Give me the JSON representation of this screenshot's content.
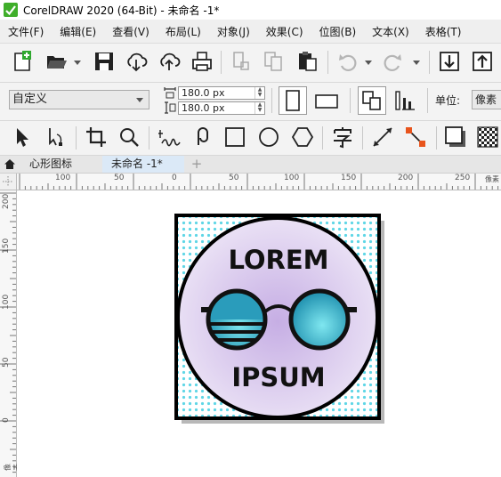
{
  "window": {
    "title": "CorelDRAW 2020 (64-Bit) - 未命名 -1*"
  },
  "menu": [
    "文件(F)",
    "编辑(E)",
    "查看(V)",
    "布局(L)",
    "对象(J)",
    "效果(C)",
    "位图(B)",
    "文本(X)",
    "表格(T)"
  ],
  "property_bar": {
    "preset": "自定义",
    "width": "180.0 px",
    "height": "180.0 px",
    "units_label": "单位:",
    "units": "像素"
  },
  "tabs": {
    "doc1": "心形图标",
    "doc2": "未命名 -1*",
    "add": "+"
  },
  "rulers": {
    "horizontal": [
      "100",
      "50",
      "0",
      "50",
      "100",
      "150",
      "200",
      "250"
    ],
    "vertical": [
      "200",
      "150",
      "100",
      "50",
      "0"
    ],
    "h_unit": "像素",
    "v_unit": "像素"
  },
  "artwork": {
    "line1": "LOREM",
    "line2": "IPSUM",
    "colors": {
      "stroke": "#000000",
      "circle_center": "#c6aee4",
      "circle_edge": "#ece4f6",
      "lens_light": "#7fe7f0",
      "lens_dark": "#1e8fae",
      "dots": "#5fd6e6",
      "shadow": "#b8b8b8"
    }
  },
  "icons": {
    "toolbar_standard": [
      "new-document-icon",
      "open-folder-icon",
      "save-icon",
      "cloud-download-icon",
      "cloud-upload-icon",
      "print-icon",
      "cut-icon",
      "copy-icon",
      "paste-icon",
      "undo-icon",
      "redo-icon",
      "import-icon",
      "export-icon"
    ],
    "toolbox": [
      "pick-tool-icon",
      "shape-tool-icon",
      "crop-tool-icon",
      "zoom-tool-icon",
      "freehand-tool-icon",
      "artistic-media-icon",
      "rectangle-tool-icon",
      "ellipse-tool-icon",
      "polygon-tool-icon",
      "text-tool-icon",
      "parallel-dimension-icon",
      "connector-tool-icon",
      "drop-shadow-icon",
      "transparency-icon"
    ]
  }
}
